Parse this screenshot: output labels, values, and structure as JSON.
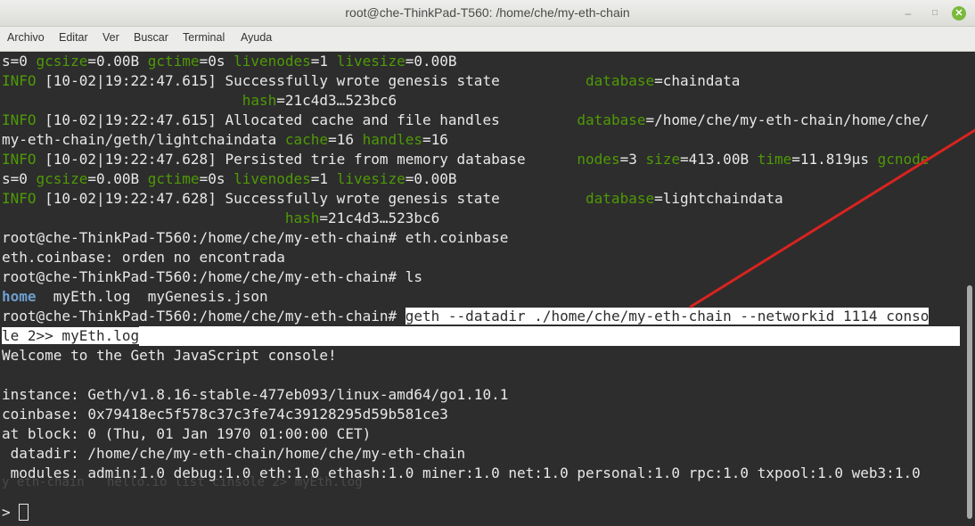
{
  "window": {
    "title": "root@che-ThinkPad-T560: /home/che/my-eth-chain",
    "minimize_glyph": "–",
    "maximize_glyph": "□",
    "close_glyph": "✕"
  },
  "menu": {
    "items": [
      "Archivo",
      "Editar",
      "Ver",
      "Buscar",
      "Terminal",
      "Ayuda"
    ]
  },
  "terminal": {
    "l0": [
      "s=0 ",
      "gcsize",
      "=0.00B ",
      "gctime",
      "=0s ",
      "livenodes",
      "=1 ",
      "livesize",
      "=0.00B"
    ],
    "l1": [
      "INFO",
      " [10-02|19:22:47.615] Successfully wrote genesis state          ",
      "database",
      "=chaindata"
    ],
    "l2": [
      "                            ",
      "hash",
      "=21c4d3…523bc6"
    ],
    "l3": [
      "INFO",
      " [10-02|19:22:47.615] Allocated cache and file handles         ",
      "database",
      "=/home/che/my-eth-chain/home/che/"
    ],
    "l4": [
      "my-eth-chain/geth/lightchaindata ",
      "cache",
      "=16 ",
      "handles",
      "=16"
    ],
    "l5": [
      "INFO",
      " [10-02|19:22:47.628] Persisted trie from memory database      ",
      "nodes",
      "=3 ",
      "size",
      "=413.00B ",
      "time",
      "=11.819µs ",
      "gcnode"
    ],
    "l6": [
      "s=0 ",
      "gcsize",
      "=0.00B ",
      "gctime",
      "=0s ",
      "livenodes",
      "=1 ",
      "livesize",
      "=0.00B"
    ],
    "l7": [
      "INFO",
      " [10-02|19:22:47.628] Successfully wrote genesis state          ",
      "database",
      "=lightchaindata"
    ],
    "l8": [
      "                                 ",
      "hash",
      "=21c4d3…523bc6"
    ],
    "l9": "root@che-ThinkPad-T560:/home/che/my-eth-chain# eth.coinbase",
    "l10": "eth.coinbase: orden no encontrada",
    "l11": "root@che-ThinkPad-T560:/home/che/my-eth-chain# ls",
    "l12": [
      "home",
      "  myEth.log  myGenesis.json"
    ],
    "l13_prompt": "root@che-ThinkPad-T560:/home/che/my-eth-chain# ",
    "l13_cmd": "geth --datadir ./home/che/my-eth-chain --networkid 1114 conso",
    "l14": "le 2>> myEth.log",
    "l15": "Welcome to the Geth JavaScript console!",
    "l16": "",
    "l17": "instance: Geth/v1.8.16-stable-477eb093/linux-amd64/go1.10.1",
    "l18": "coinbase: 0x79418ec5f578c37c3fe74c39128295d59b581ce3",
    "l19": "at block: 0 (Thu, 01 Jan 1970 01:00:00 CET)",
    "l20": " datadir: /home/che/my-eth-chain/home/che/my-eth-chain",
    "l21": " modules: admin:1.0 debug:1.0 eth:1.0 ethash:1.0 miner:1.0 net:1.0 personal:1.0 rpc:1.0 txpool:1.0 web3:1.0",
    "l22": "",
    "prompt_symbol": "> "
  },
  "annotation": {
    "arrow_color": "#d9231f"
  }
}
